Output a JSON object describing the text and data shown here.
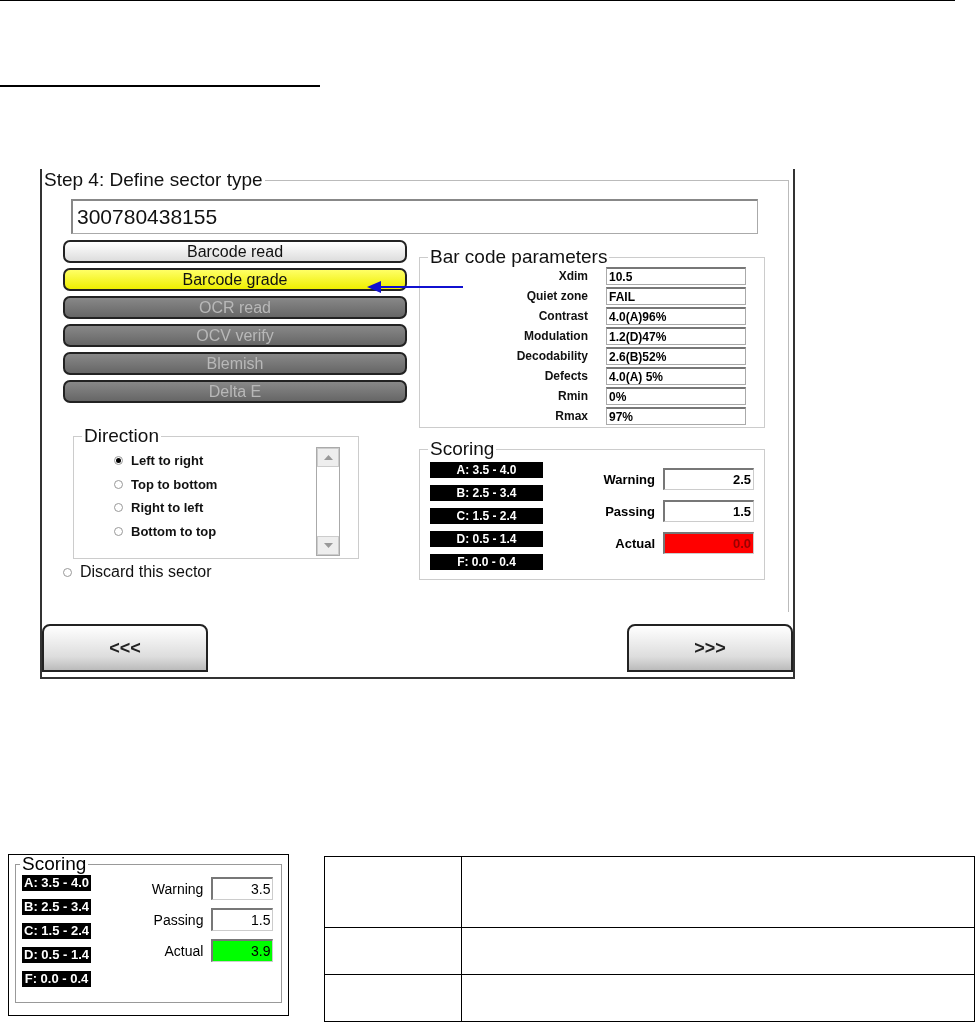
{
  "wizard": {
    "step_title": "Step 4: Define sector type",
    "code_field": {
      "value": "300780438155"
    },
    "sector_types": [
      {
        "label": "Barcode read",
        "selected": false,
        "disabled": false
      },
      {
        "label": "Barcode grade",
        "selected": true,
        "disabled": false
      },
      {
        "label": "OCR read",
        "selected": false,
        "disabled": true
      },
      {
        "label": "OCV verify",
        "selected": false,
        "disabled": true
      },
      {
        "label": "Blemish",
        "selected": false,
        "disabled": true
      },
      {
        "label": "Delta E",
        "selected": false,
        "disabled": true
      }
    ],
    "barcode_parameters": {
      "title": "Bar code parameters",
      "rows": [
        {
          "name": "Xdim",
          "value": "10.5"
        },
        {
          "name": "Quiet zone",
          "value": "FAIL"
        },
        {
          "name": "Contrast",
          "value": "4.0(A)96%"
        },
        {
          "name": "Modulation",
          "value": "1.2(D)47%"
        },
        {
          "name": "Decodability",
          "value": "2.6(B)52%"
        },
        {
          "name": "Defects",
          "value": "4.0(A) 5%"
        },
        {
          "name": "Rmin",
          "value": "0%"
        },
        {
          "name": "Rmax",
          "value": "97%"
        }
      ]
    },
    "direction": {
      "title": "Direction",
      "options": [
        {
          "label": "Left to right",
          "selected": true
        },
        {
          "label": "Top to bottom",
          "selected": false
        },
        {
          "label": "Right to left",
          "selected": false
        },
        {
          "label": "Bottom to top",
          "selected": false
        }
      ]
    },
    "discard": {
      "label": "Discard this sector",
      "selected": false
    },
    "scoring": {
      "title": "Scoring",
      "grades": [
        "A: 3.5 - 4.0",
        "B: 2.5 - 3.4",
        "C: 1.5 - 2.4",
        "D: 0.5 - 1.4",
        "F: 0.0 - 0.4"
      ],
      "warning": {
        "label": "Warning",
        "value": "2.5"
      },
      "passing": {
        "label": "Passing",
        "value": "1.5"
      },
      "actual": {
        "label": "Actual",
        "value": "0.0",
        "passed": false
      }
    },
    "buttons": {
      "back": "<<<",
      "next": ">>>"
    }
  },
  "scoring_example": {
    "title": "Scoring",
    "grades": [
      "A: 3.5 - 4.0",
      "B: 2.5 - 3.4",
      "C: 1.5 - 2.4",
      "D: 0.5 - 1.4",
      "F: 0.0 - 0.4"
    ],
    "warning": {
      "label": "Warning",
      "value": "3.5"
    },
    "passing": {
      "label": "Passing",
      "value": "1.5"
    },
    "actual": {
      "label": "Actual",
      "value": "3.9",
      "passed": true
    }
  }
}
